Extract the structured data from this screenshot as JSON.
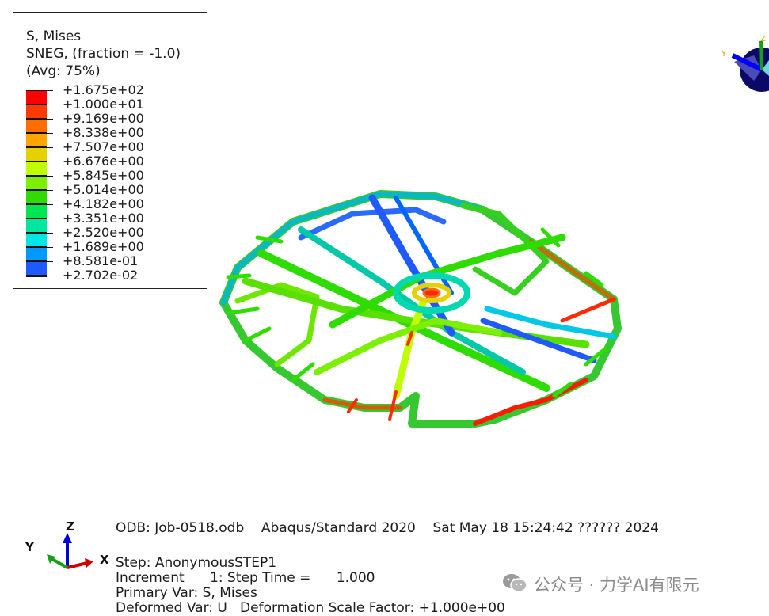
{
  "legend": {
    "title_line1": "S, Mises",
    "title_line2": "SNEG, (fraction = -1.0)",
    "title_line3": "(Avg: 75%)",
    "values": [
      "+1.675e+02",
      "+1.000e+01",
      "+9.169e+00",
      "+8.338e+00",
      "+7.507e+00",
      "+6.676e+00",
      "+5.845e+00",
      "+5.014e+00",
      "+4.182e+00",
      "+3.351e+00",
      "+2.520e+00",
      "+1.689e+00",
      "+8.581e-01",
      "+2.702e-02"
    ],
    "colors": [
      "#ff0000",
      "#ff3a00",
      "#ff6d00",
      "#ffa500",
      "#e4d200",
      "#bfff00",
      "#7cf000",
      "#2fdc00",
      "#00e650",
      "#00e6a0",
      "#00e6e6",
      "#0099ff",
      "#1e5aff",
      "#0000ff"
    ]
  },
  "triad_top_right": {
    "y_label": "Y",
    "z_label": "Z"
  },
  "triad_bottom_left": {
    "z_label": "Z",
    "y_label": "Y",
    "x_label": "X"
  },
  "info": {
    "odb_line": "ODB: Job-0518.odb    Abaqus/Standard 2020    Sat May 18 15:24:42 ?????? 2024",
    "step_line": "Step: AnonymousSTEP1",
    "increment_line": "Increment      1: Step Time =      1.000",
    "primary_var_line": "Primary Var: S, Mises",
    "deformed_var_line": "Deformed Var: U   Deformation Scale Factor: +1.000e+00"
  },
  "watermark": {
    "text": "公众号 · 力学AI有限元"
  }
}
